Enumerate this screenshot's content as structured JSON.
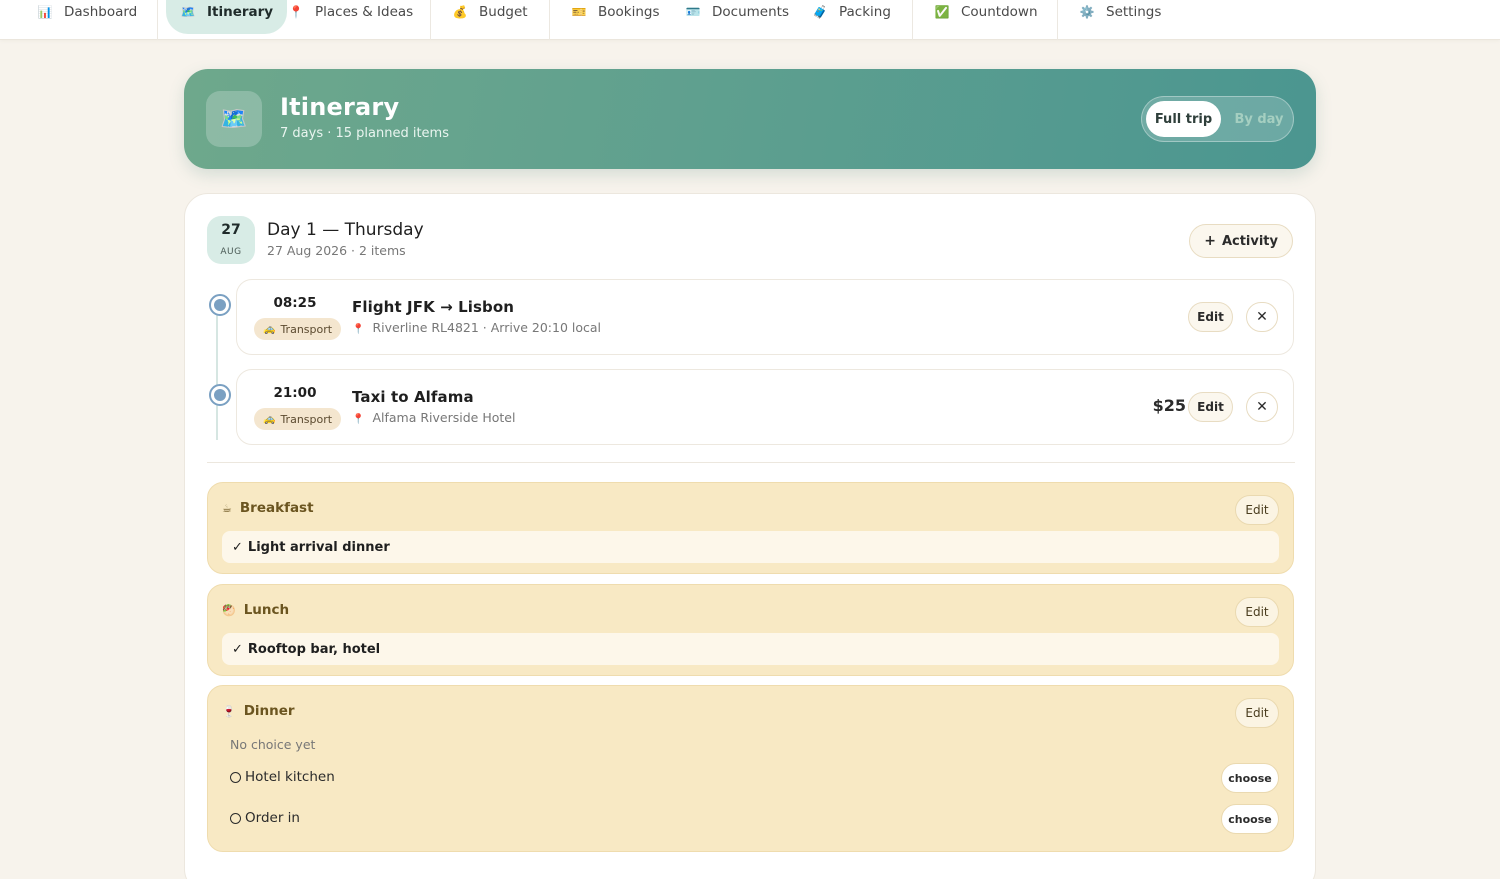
{
  "nav": {
    "items": [
      {
        "label": "Dashboard",
        "icon": "📊"
      },
      {
        "label": "Itinerary",
        "icon": "🗺️",
        "active": true
      },
      {
        "label": "Places & Ideas",
        "icon": "📍"
      },
      {
        "label": "Budget",
        "icon": "💰"
      },
      {
        "label": "Bookings",
        "icon": "🎫"
      },
      {
        "label": "Documents",
        "icon": "🪪"
      },
      {
        "label": "Packing",
        "icon": "🧳"
      },
      {
        "label": "Countdown",
        "icon": "✅"
      },
      {
        "label": "Settings",
        "icon": "⚙️"
      }
    ]
  },
  "header": {
    "icon": "🗺️",
    "title": "Itinerary",
    "subtitle": "7 days · 15 planned items",
    "view_toggle": {
      "full": "Full trip",
      "by_day": "By day"
    }
  },
  "day": {
    "date_day": "27",
    "date_month": "AUG",
    "title": "Day 1 — Thursday",
    "subtitle": "27 Aug 2026 · 2 items",
    "add_label": "Activity",
    "add_icon": "+"
  },
  "activities": [
    {
      "time": "08:25",
      "tag": "Transport",
      "tag_icon": "🚕",
      "title": "Flight JFK → Lisbon",
      "location": "Riverline RL4821 · Arrive 20:10 local",
      "price": "",
      "edit_label": "Edit",
      "close_icon": "✕"
    },
    {
      "time": "21:00",
      "tag": "Transport",
      "tag_icon": "🚕",
      "title": "Taxi to Alfama",
      "location": "Alfama Riverside Hotel",
      "price": "$25",
      "edit_label": "Edit",
      "close_icon": "✕"
    }
  ],
  "meals": {
    "breakfast": {
      "icon": "☕",
      "label": "Breakfast",
      "edit_label": "Edit",
      "choice": "Light arrival dinner"
    },
    "lunch": {
      "icon": "🥙",
      "label": "Lunch",
      "edit_label": "Edit",
      "choice": "Rooftop bar, hotel"
    },
    "dinner": {
      "icon": "🍷",
      "label": "Dinner",
      "edit_label": "Edit",
      "no_choice": "No choice yet",
      "options": [
        {
          "label": "Hotel kitchen",
          "button": "choose"
        },
        {
          "label": "Order in",
          "button": "choose"
        }
      ]
    }
  },
  "colors": {
    "accent": "#5fa08f",
    "hero_start": "#6ea88c",
    "hero_end": "#4b9690",
    "meal_bg": "#f8e9c4",
    "timeline_dot": "#7aa0c2"
  }
}
